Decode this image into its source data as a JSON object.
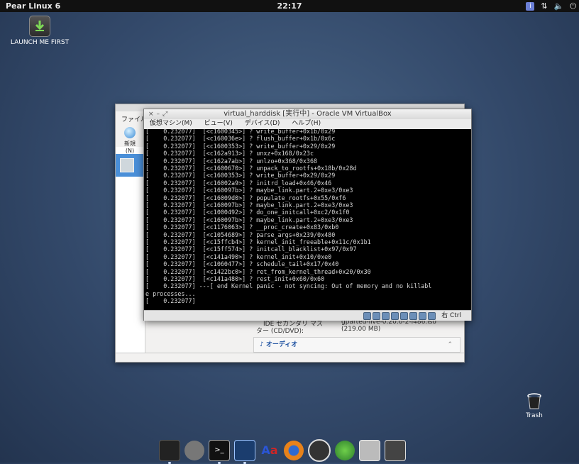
{
  "topbar": {
    "distro": "Pear Linux 6",
    "clock": "22:17"
  },
  "desktop": {
    "launch_icon_label": "LAUNCH ME FIRST",
    "trash_label": "Trash"
  },
  "manager_window": {
    "menu_file": "ファイル",
    "new_button": "新規(N)",
    "ide_label": "IDE セカンダリ マス",
    "ide_value": "gparted-live-0.20.0-2-i486.iso",
    "cd_label": "ター (CD/DVD):",
    "cd_size": "(219.00 MB)",
    "audio_section": "オーディオ"
  },
  "vm_window": {
    "title": "virtual_harddisk [実行中] - Oracle VM VirtualBox",
    "menus": [
      "仮想マシン(M)",
      "ビュー(V)",
      "デバイス(D)",
      "ヘルプ(H)"
    ],
    "host_key": "右 Ctrl",
    "console_lines": [
      "[    0.232077]  [<c1600345>] ? write_buffer+0x1b/0x29",
      "[    0.232077]  [<c160036e>] ? flush_buffer+0x1b/0x6c",
      "[    0.232077]  [<c1600353>] ? write_buffer+0x29/0x29",
      "[    0.232077]  [<c162a913>] ? unxz+0x168/0x23c",
      "[    0.232077]  [<c162a7ab>] ? unlzo+0x368/0x368",
      "[    0.232077]  [<c1600670>] ? unpack_to_rootfs+0x18b/0x28d",
      "[    0.232077]  [<c1600353>] ? write_buffer+0x29/0x29",
      "[    0.232077]  [<c16002a9>] ? initrd_load+0x46/0x46",
      "[    0.232077]  [<c160097b>] ? maybe_link.part.2+0xe3/0xe3",
      "[    0.232077]  [<c16009d0>] ? populate_rootfs+0x55/0xf6",
      "[    0.232077]  [<c160097b>] ? maybe_link.part.2+0xe3/0xe3",
      "[    0.232077]  [<c1000492>] ? do_one_initcall+0xc2/0x1f0",
      "[    0.232077]  [<c160097b>] ? maybe_link.part.2+0xe3/0xe3",
      "[    0.232077]  [<c1176063>] ? __proc_create+0x83/0xb0",
      "[    0.232077]  [<c1054689>] ? parse_args+0x239/0x480",
      "[    0.232077]  [<c15ffcb4>] ? kernel_init_freeable+0x11c/0x1b1",
      "[    0.232077]  [<c15ff574>] ? initcall_blacklist+0x97/0x97",
      "[    0.232077]  [<c141a490>] ? kernel_init+0x10/0xe0",
      "[    0.232077]  [<c1060477>] ? schedule_tail+0x17/0x40",
      "[    0.232077]  [<c1422bc0>] ? ret_from_kernel_thread+0x20/0x30",
      "[    0.232077]  [<c141a480>] ? rest_init+0x60/0x60",
      "[    0.232077] ---[ end Kernel panic - not syncing: Out of memory and no killabl",
      "e processes...",
      "[    0.232077]"
    ]
  },
  "dock": {
    "items": [
      "monitor-icon",
      "rocket-icon",
      "terminal-icon",
      "system-monitor-icon",
      "font-icon",
      "firefox-icon",
      "app-store-icon",
      "network-icon",
      "camera-icon",
      "settings-icon"
    ]
  },
  "colors": {
    "accent": "#4a8fd8",
    "console_bg": "#000000"
  }
}
